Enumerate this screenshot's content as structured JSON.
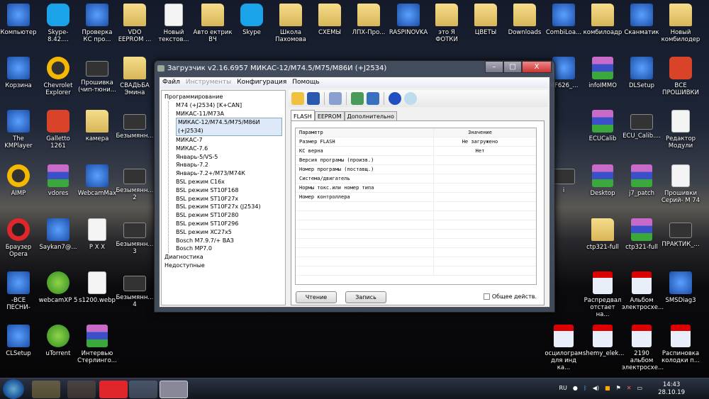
{
  "desktop_icons": [
    {
      "label": "Компьютер",
      "icon": "app"
    },
    {
      "label": "Skype-8.42....",
      "icon": "skype"
    },
    {
      "label": "Проверка КС про...",
      "icon": "app"
    },
    {
      "label": "VDO EEPROM ...",
      "icon": "folder"
    },
    {
      "label": "Новый текстов...",
      "icon": "file"
    },
    {
      "label": "Авто ектрик ВЧ",
      "icon": "folder"
    },
    {
      "label": "Skype",
      "icon": "skype"
    },
    {
      "label": "Школа Пахомова",
      "icon": "folder"
    },
    {
      "label": "СХЕМЫ",
      "icon": "folder"
    },
    {
      "label": "ЛПХ-Про...",
      "icon": "folder"
    },
    {
      "label": "RASPINOVKA",
      "icon": "app"
    },
    {
      "label": "это Я ФОТКИ",
      "icon": "folder"
    },
    {
      "label": "ЦВЕТЫ",
      "icon": "folder"
    },
    {
      "label": "Downloads",
      "icon": "folder"
    },
    {
      "label": "CombiLoa...",
      "icon": "app"
    },
    {
      "label": "комбилоадр",
      "icon": "folder"
    },
    {
      "label": "Сканматик",
      "icon": "app"
    },
    {
      "label": "Новый комбилодер",
      "icon": "folder"
    },
    {
      "label": "Корзина",
      "icon": "app"
    },
    {
      "label": "Chevrolet Explorer",
      "icon": "yellow"
    },
    {
      "label": "Прошивка (чип-тюни...",
      "icon": "video"
    },
    {
      "label": "СВАДЬБА Эмина",
      "icon": "folder"
    },
    {
      "label": "The KMPlayer",
      "icon": "app"
    },
    {
      "label": "Galletto 1261",
      "icon": "red"
    },
    {
      "label": "камера",
      "icon": "folder"
    },
    {
      "label": "Безымянн...",
      "icon": "video"
    },
    {
      "label": "AIMP",
      "icon": "yellow"
    },
    {
      "label": "vdores",
      "icon": "winrar"
    },
    {
      "label": "WebcamMax",
      "icon": "app"
    },
    {
      "label": "Безымянн... 2",
      "icon": "video"
    },
    {
      "label": "Браузер Opera",
      "icon": "opera"
    },
    {
      "label": "Saykan7@...",
      "icon": "app"
    },
    {
      "label": "P X X",
      "icon": "file"
    },
    {
      "label": "Безымянн... 3",
      "icon": "video"
    },
    {
      "label": "-ВСЕ ПЕСНИ-",
      "icon": "app"
    },
    {
      "label": "webcamXP 5",
      "icon": "green"
    },
    {
      "label": "s1200.webp",
      "icon": "file"
    },
    {
      "label": "Безымянн... 4",
      "icon": "video"
    },
    {
      "label": "CLSetup",
      "icon": "app"
    },
    {
      "label": "uTorrent",
      "icon": "green"
    },
    {
      "label": "Интервью Стерлинго...",
      "icon": "winrar"
    },
    {
      "label": "MF626_...",
      "icon": "app"
    },
    {
      "label": "infoIMMO",
      "icon": "winrar"
    },
    {
      "label": "DLSetup",
      "icon": "app"
    },
    {
      "label": "ВСЕ ПРОШИВКИ",
      "icon": "red"
    },
    {
      "label": "ECUCalib",
      "icon": "winrar"
    },
    {
      "label": "ECU_Calib....",
      "icon": "video"
    },
    {
      "label": "Редактор Модули",
      "icon": "file"
    },
    {
      "label": "i",
      "icon": "video"
    },
    {
      "label": "Desktop",
      "icon": "winrar"
    },
    {
      "label": "j7_patch",
      "icon": "winrar"
    },
    {
      "label": "Прошивки Серий- М 74",
      "icon": "file"
    },
    {
      "label": "ctp321-full",
      "icon": "folder"
    },
    {
      "label": "ctp321-full",
      "icon": "winrar"
    },
    {
      "label": "ПРАКТИК_...",
      "icon": "video"
    },
    {
      "label": "Распредвал отстает на...",
      "icon": "pdf"
    },
    {
      "label": "Альбом электросхе...",
      "icon": "pdf"
    },
    {
      "label": "SMSDiag3",
      "icon": "app"
    },
    {
      "label": "осцилограм для инд ка...",
      "icon": "pdf"
    },
    {
      "label": "shemy_elek...",
      "icon": "pdf"
    },
    {
      "label": "2190 альбом электросхе...",
      "icon": "pdf"
    },
    {
      "label": "Распиновка колодки п...",
      "icon": "pdf"
    }
  ],
  "window": {
    "title": "Загрузчик v2.16.6957 МИКАС-12/М74.5/М75/М86И (+J2534)",
    "controls": {
      "minimize": "–",
      "maximize": "□",
      "close": "X"
    },
    "menu": {
      "file": "Файл",
      "tools": "Инструменты",
      "config": "Конфигурация",
      "help": "Помощь"
    },
    "tree": {
      "root": "Программирование",
      "items": [
        "М74 (+J2534) [K+CAN]",
        "МИКАС-11/М73А",
        "МИКАС-12/М74.5/М75/М86И (+J2534)",
        "МИКАС-7",
        "МИКАС-7.6",
        "Январь-5/VS-5",
        "Январь-7.2",
        "Январь-7.2+/М73/М74К",
        "BSL режим C16x",
        "BSL режим ST10F168",
        "BSL режим ST10F27x",
        "BSL режим ST10F27x (J2534)",
        "BSL режим ST10F280",
        "BSL режим ST10F296",
        "BSL режим XC27x5",
        "Bosch M7.9.7/+ ВАЗ",
        "Bosch MP7.0"
      ],
      "selected_index": 2,
      "diag": "Диагностика",
      "unavailable": "Недоступные"
    },
    "tabs": [
      "FLASH",
      "EEPROM",
      "Дополнительно"
    ],
    "table": {
      "headers": [
        "Параметр",
        "Значение"
      ],
      "rows": [
        [
          "Размер FLASH",
          "Не загружено"
        ],
        [
          "КС верна",
          "Нет"
        ],
        [
          "Версия програмы (произв.)",
          ""
        ],
        [
          "Номер програмы (поставщ.)",
          ""
        ],
        [
          "Система/двигатель",
          ""
        ],
        [
          "Нормы токс.или номер типа",
          ""
        ],
        [
          "Номер контроллера",
          ""
        ]
      ]
    },
    "read_button": "Чтение",
    "write_button": "Запись",
    "common_action": "Общее действ."
  },
  "taskbar": {
    "lang": "RU",
    "time": "14:43",
    "date": "28.10.19"
  }
}
